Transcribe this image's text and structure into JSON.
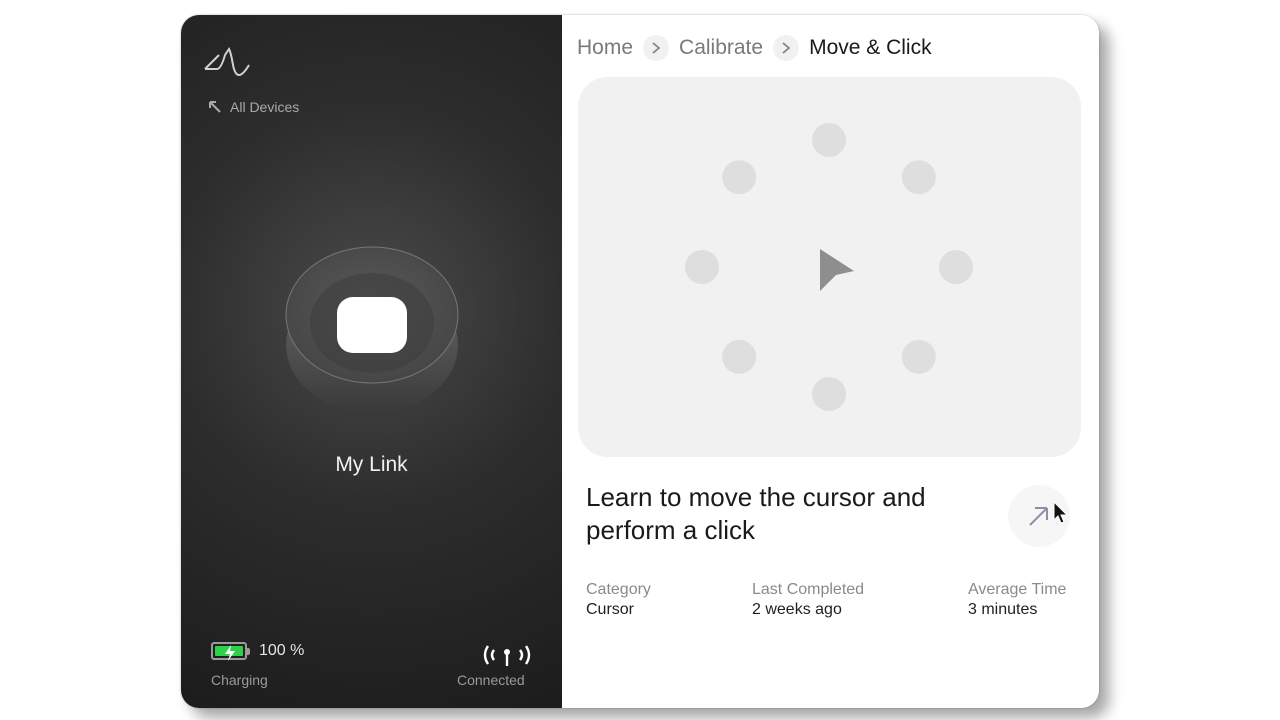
{
  "sidebar": {
    "logo_icon": "waveform-logo-icon",
    "back_label": "All Devices",
    "back_icon": "arrow-up-left-icon",
    "device_name": "My Link",
    "battery": {
      "percent_text": "100 %",
      "status": "Charging",
      "level": 1.0,
      "color": "#2ed14a"
    },
    "connection": {
      "label": "Connected",
      "icon": "wireless-signal-icon"
    }
  },
  "breadcrumb": {
    "items": [
      "Home",
      "Calibrate",
      "Move & Click"
    ]
  },
  "exercise": {
    "title": "Learn to move the cursor and perform a click",
    "open_icon": "arrow-up-right-icon",
    "stage_icon": "pointer-arrow-icon",
    "target_dot_count": 8,
    "meta": [
      {
        "key": "Category",
        "value": "Cursor"
      },
      {
        "key": "Last Completed",
        "value": "2 weeks ago"
      },
      {
        "key": "Average Time",
        "value": "3 minutes"
      }
    ]
  }
}
